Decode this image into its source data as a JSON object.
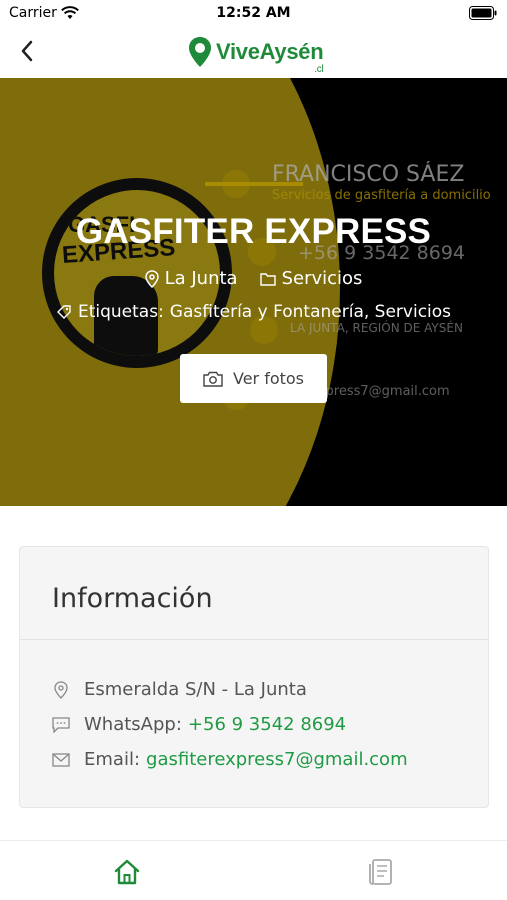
{
  "status_bar": {
    "carrier": "Carrier",
    "time": "12:52 AM"
  },
  "nav": {
    "logo_text": "ViveAysén",
    "logo_suffix": ".cl"
  },
  "hero": {
    "title": "GASFITER EXPRESS",
    "location": "La Junta",
    "category": "Servicios",
    "tags_label": "Etiquetas:",
    "tags_value": "Gasfitería y Fontanería, Servicios",
    "button_label": "Ver fotos",
    "card_text": {
      "name": "FRANCISCO SÁEZ",
      "subtitle": "Servicios de gasfitería a domicilio",
      "phone": "+56 9 3542 8694",
      "region": "LA JUNTA, REGIÓN DE AYSÉN",
      "email": "rexpress7@gmail.com",
      "logo_line1": "GASFI",
      "logo_line2": "EXPRESS"
    }
  },
  "info": {
    "title": "Información",
    "address": "Esmeralda S/N - La Junta",
    "whatsapp_label": "WhatsApp:",
    "whatsapp_value": "+56 9 3542 8694",
    "email_label": "Email:",
    "email_value": "gasfiterexpress7@gmail.com"
  },
  "colors": {
    "brand_green": "#1e8a3a",
    "link_green": "#1f9a45",
    "hero_yellow": "#a38c10"
  },
  "tab_bar": {
    "items": [
      "home-icon",
      "list-icon"
    ]
  }
}
